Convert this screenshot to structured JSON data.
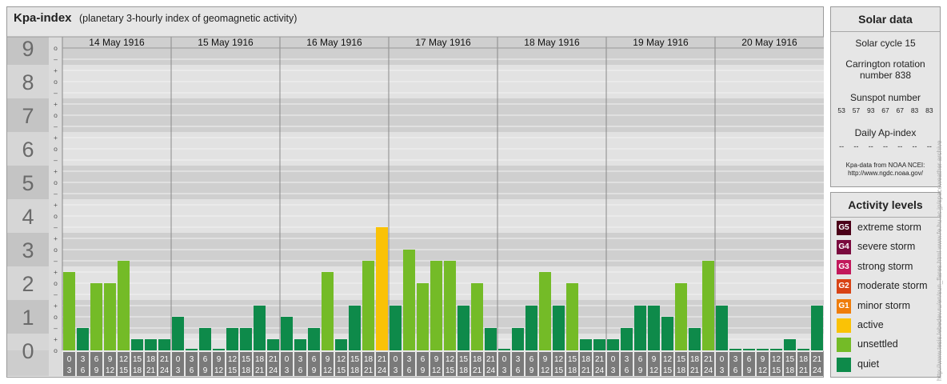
{
  "header": {
    "title": "Kpa-index",
    "subtitle": "(planetary 3-hourly index of geomagnetic activity)"
  },
  "chart_data": {
    "type": "bar",
    "title": "Kpa-index",
    "subtitle": "(planetary 3-hourly index of geomagnetic activity)",
    "ylim": [
      0,
      9
    ],
    "y_ticks": [
      "0",
      "1",
      "2",
      "3",
      "4",
      "5",
      "6",
      "7",
      "8",
      "9"
    ],
    "sub_ticks": [
      "o",
      "+",
      "–"
    ],
    "days": [
      "14 May 1916",
      "15 May 1916",
      "16 May 1916",
      "17 May 1916",
      "18 May 1916",
      "19 May 1916",
      "20 May 1916"
    ],
    "interval_start": [
      "0",
      "3",
      "6",
      "9",
      "12",
      "15",
      "18",
      "21"
    ],
    "interval_end": [
      "3",
      "6",
      "9",
      "12",
      "15",
      "18",
      "21",
      "24"
    ],
    "values": [
      [
        2.333,
        0.667,
        2.0,
        2.0,
        2.667,
        0.333,
        0.333,
        0.333
      ],
      [
        1.0,
        0.0,
        0.667,
        0.0,
        0.667,
        0.667,
        1.333,
        0.333
      ],
      [
        1.0,
        0.333,
        0.667,
        2.333,
        0.333,
        1.333,
        2.667,
        3.667
      ],
      [
        1.333,
        3.0,
        2.0,
        2.667,
        2.667,
        1.333,
        2.0,
        0.667
      ],
      [
        0.0,
        0.667,
        1.333,
        2.333,
        1.333,
        2.0,
        0.333,
        0.333
      ],
      [
        0.333,
        0.667,
        1.333,
        1.333,
        1.0,
        2.0,
        0.667,
        2.667
      ],
      [
        1.333,
        0.0,
        0.0,
        0.0,
        0.0,
        0.333,
        0.0,
        1.333
      ]
    ],
    "colors": {
      "quiet": "#0e8a4a",
      "unsettled": "#74bb27",
      "active": "#fac206"
    },
    "grid": true,
    "legend": "right"
  },
  "solar": {
    "title": "Solar data",
    "cycle": "Solar cycle 15",
    "carrington_line1": "Carrington rotation",
    "carrington_line2": "number 838",
    "sunspot_label": "Sunspot number",
    "sunspots": [
      "53",
      "57",
      "93",
      "67",
      "67",
      "83",
      "83"
    ],
    "ap_label": "Daily Ap-index",
    "ap_values": [
      "--",
      "--",
      "--",
      "--",
      "--",
      "--",
      "--"
    ],
    "credit_line1": "Kpa-data from NOAA NCEI:",
    "credit_line2": "http://www.ngdc.noaa.gov/"
  },
  "activity": {
    "title": "Activity levels",
    "levels": [
      {
        "code": "G5",
        "label": "extreme storm",
        "color": "#4b0018"
      },
      {
        "code": "G4",
        "label": "severe storm",
        "color": "#7a0a3e"
      },
      {
        "code": "G3",
        "label": "strong storm",
        "color": "#c2185b"
      },
      {
        "code": "G2",
        "label": "moderate storm",
        "color": "#d84315"
      },
      {
        "code": "G1",
        "label": "minor storm",
        "color": "#ef7d0b"
      },
      {
        "code": "",
        "label": "active",
        "color": "#fac206"
      },
      {
        "code": "",
        "label": "unsettled",
        "color": "#74bb27"
      },
      {
        "code": "",
        "label": "quiet",
        "color": "#0e8a4a"
      }
    ]
  },
  "watermark": "http://www.tesis.lebedev.ru/en/sun_flares.html www.fe.hu.ac.jp/spaceweather archive"
}
